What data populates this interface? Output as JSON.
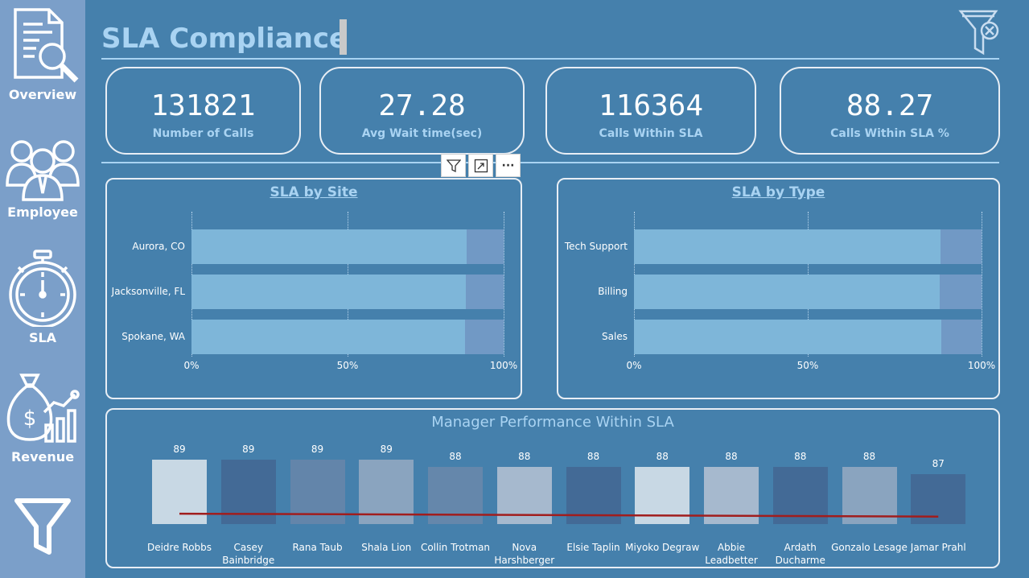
{
  "header": {
    "title": "SLA Compliance"
  },
  "nav": [
    {
      "label": "Overview",
      "icon": "report-search-icon"
    },
    {
      "label": "Employee",
      "icon": "people-group-icon"
    },
    {
      "label": "SLA",
      "icon": "stopwatch-icon"
    },
    {
      "label": "Revenue",
      "icon": "money-bag-chart-icon"
    },
    {
      "label": "",
      "icon": "filter-icon"
    }
  ],
  "kpis": [
    {
      "value": "131821",
      "label": "Number of Calls"
    },
    {
      "value": "27.28",
      "label": "Avg Wait time(sec)"
    },
    {
      "value": "116364",
      "label": "Calls Within SLA"
    },
    {
      "value": "88.27",
      "label": "Calls Within SLA %"
    }
  ],
  "visual_header": {
    "icons": [
      "filter-icon",
      "focus-mode-icon",
      "more-options-icon"
    ],
    "more_label": "···"
  },
  "colors": {
    "background": "#4580AC",
    "sidebar": "#7B9FC9",
    "accent_text": "#A9D3F2",
    "bar_within": "#7EB6D9",
    "bar_outside": "#7199C5",
    "trend_line": "#A11D1D"
  },
  "chart_data": [
    {
      "type": "bar",
      "orientation": "horizontal",
      "stacked": true,
      "percent": true,
      "title": "SLA by Site",
      "categories": [
        "Aurora, CO",
        "Jacksonville, FL",
        "Spokane, WA"
      ],
      "series": [
        {
          "values": [
            88.2,
            88.0,
            87.7
          ]
        },
        {
          "values": [
            11.8,
            12.0,
            12.3
          ]
        }
      ],
      "xlim": [
        0,
        100
      ],
      "xticks": [
        "0%",
        "50%",
        "100%"
      ],
      "grid": true
    },
    {
      "type": "bar",
      "orientation": "horizontal",
      "stacked": true,
      "percent": true,
      "title": "SLA by Type",
      "categories": [
        "Tech Support",
        "Billing",
        "Sales"
      ],
      "series": [
        {
          "values": [
            88.1,
            87.9,
            88.4
          ]
        },
        {
          "values": [
            11.9,
            12.1,
            11.6
          ]
        }
      ],
      "xlim": [
        0,
        100
      ],
      "xticks": [
        "0%",
        "50%",
        "100%"
      ],
      "grid": true
    },
    {
      "type": "bar",
      "orientation": "vertical",
      "title": "Manager Performance Within SLA",
      "categories": [
        "Deidre Robbs",
        "Casey Bainbridge",
        "Rana Taub",
        "Shala Lion",
        "Collin Trotman",
        "Nova Harshberger",
        "Elsie Taplin",
        "Miyoko Degraw",
        "Abbie Leadbetter",
        "Ardath Ducharme",
        "Gonzalo Lesage",
        "Jamar Prahl"
      ],
      "values": [
        89,
        89,
        89,
        89,
        88,
        88,
        88,
        88,
        88,
        88,
        88,
        87
      ],
      "bar_colors": [
        "#C8D8E4",
        "#436A96",
        "#6385AA",
        "#8AA4BF",
        "#6587AB",
        "#A6B9CE",
        "#436A96",
        "#C8D8E4",
        "#A6B9CE",
        "#436A96",
        "#8AA4BF",
        "#436A96"
      ],
      "trend_line": true,
      "data_labels": true
    }
  ]
}
